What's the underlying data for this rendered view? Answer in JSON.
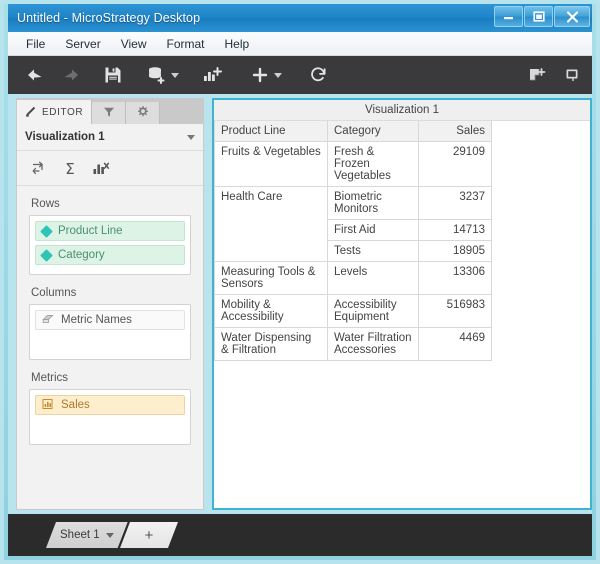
{
  "window": {
    "title": "Untitled - MicroStrategy Desktop",
    "controls": [
      {
        "name": "minimize-button",
        "glyph": "—"
      },
      {
        "name": "maximize-button",
        "glyph": "❐"
      },
      {
        "name": "close-button",
        "glyph": "✕"
      }
    ]
  },
  "menubar": {
    "items": [
      "File",
      "Server",
      "View",
      "Format",
      "Help"
    ]
  },
  "toolbar": {
    "buttons": [
      {
        "name": "undo-icon",
        "label": "Undo",
        "enabled": true
      },
      {
        "name": "redo-icon",
        "label": "Redo",
        "enabled": false
      },
      {
        "name": "save-icon",
        "label": "Save",
        "enabled": true
      },
      {
        "name": "add-dataset-icon",
        "label": "Add Dataset",
        "enabled": true,
        "has_caret": true
      },
      {
        "name": "add-visualization-icon",
        "label": "Add Visualization",
        "enabled": true
      },
      {
        "name": "insert-icon",
        "label": "Insert",
        "enabled": true,
        "has_caret": true
      },
      {
        "name": "refresh-icon",
        "label": "Refresh",
        "enabled": true
      }
    ],
    "right_buttons": [
      {
        "name": "new-document-icon",
        "label": "New Document"
      },
      {
        "name": "present-icon",
        "label": "Presentation Mode"
      }
    ]
  },
  "editor": {
    "tabs": [
      {
        "name": "tab-editor",
        "label": "EDITOR",
        "icon": "pencil-icon",
        "active": true
      },
      {
        "name": "tab-filters",
        "label": "",
        "icon": "filter-icon",
        "active": false
      },
      {
        "name": "tab-properties",
        "label": "",
        "icon": "gear-icon",
        "active": false
      }
    ],
    "subheader": {
      "title": "Visualization 1",
      "caret": "chevron-down-icon"
    },
    "tool_icons": [
      {
        "name": "swap-rows-columns-icon",
        "label": "Swap Rows and Columns"
      },
      {
        "name": "totals-icon",
        "label": "Totals"
      },
      {
        "name": "visualization-type-icon",
        "label": "Change Visualization"
      }
    ],
    "zones": [
      {
        "name": "rows-zone",
        "label": "Rows",
        "items": [
          {
            "name": "pill-product-line",
            "label": "Product Line",
            "kind": "attribute"
          },
          {
            "name": "pill-category",
            "label": "Category",
            "kind": "attribute"
          }
        ]
      },
      {
        "name": "columns-zone",
        "label": "Columns",
        "items": [
          {
            "name": "pill-metric-names",
            "label": "Metric Names",
            "kind": "metric-names"
          }
        ]
      },
      {
        "name": "metrics-zone",
        "label": "Metrics",
        "items": [
          {
            "name": "pill-sales",
            "label": "Sales",
            "kind": "metric"
          }
        ]
      }
    ]
  },
  "visualization": {
    "title": "Visualization 1",
    "table": {
      "columns": [
        "Product Line",
        "Category",
        "Sales"
      ],
      "rows": [
        {
          "product_line": "Fruits & Vegetables",
          "product_line_span": 1,
          "category": "Fresh & Frozen Vegetables",
          "sales": "29109"
        },
        {
          "product_line": "Health Care",
          "product_line_span": 3,
          "category": "Biometric Monitors",
          "sales": "3237"
        },
        {
          "product_line": "",
          "product_line_span": 0,
          "category": "First Aid",
          "sales": "14713"
        },
        {
          "product_line": "",
          "product_line_span": 0,
          "category": "Tests",
          "sales": "18905"
        },
        {
          "product_line": "Measuring Tools & Sensors",
          "product_line_span": 1,
          "category": "Levels",
          "sales": "13306"
        },
        {
          "product_line": "Mobility & Accessibility",
          "product_line_span": 1,
          "category": "Accessibility Equipment",
          "sales": "516983"
        },
        {
          "product_line": "Water Dispensing & Filtration",
          "product_line_span": 1,
          "category": "Water Filtration Accessories",
          "sales": "4469"
        }
      ]
    }
  },
  "bottombar": {
    "sheet_tab": "Sheet 1",
    "add_sheet": "+"
  },
  "colors": {
    "titlebar": "#1e84c8",
    "toolbar": "#3a3a3c",
    "accent_teal": "#3fb3cf",
    "attribute_pill": "#ddf3e5",
    "attribute_text": "#4b8f73",
    "metric_pill": "#fdeecd",
    "metric_text": "#b07a28",
    "window_frame": "#b7e3ec",
    "bottombar": "#2b2b2b"
  }
}
